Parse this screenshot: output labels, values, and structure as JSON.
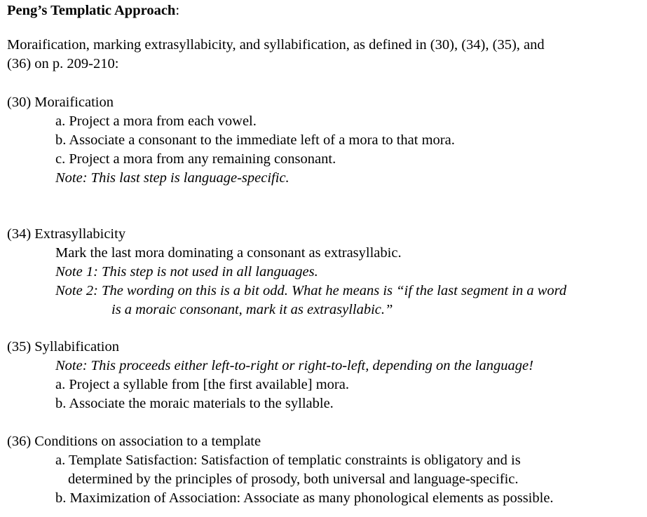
{
  "header": {
    "title": "Peng’s Templatic Approach",
    "title_suffix": ":"
  },
  "intro": {
    "line1": "Moraification, marking extrasyllabicity, and syllabification, as defined in (30), (34), (35), and",
    "line2": "(36) on p. 209-210:"
  },
  "sections": {
    "s30": {
      "heading": "(30) Moraification",
      "a": "a. Project a mora from each vowel.",
      "b": "b. Associate a consonant to the immediate left of a mora to that mora.",
      "c": "c. Project a mora from any remaining consonant.",
      "note": "Note: This last step is language-specific."
    },
    "s34": {
      "heading": "(34) Extrasyllabicity",
      "text": "Mark the last mora dominating a consonant as extrasyllabic.",
      "note1": "Note 1: This step is not used in all languages.",
      "note2_line1": "Note 2: The wording on this is a bit odd. What he means is “if the last segment in a word",
      "note2_line2": "is a moraic consonant, mark it as extrasyllabic.”"
    },
    "s35": {
      "heading": "(35) Syllabification",
      "note": "Note: This proceeds either left-to-right or right-to-left, depending on the language!",
      "a": "a. Project a syllable from [the first available] mora.",
      "b": "b. Associate the moraic materials to the syllable."
    },
    "s36": {
      "heading": "(36) Conditions on association to a template",
      "a_line1": "a. Template Satisfaction: Satisfaction of templatic constraints is obligatory and is",
      "a_line2": "determined by the principles of prosody, both universal and language-specific.",
      "b": "b. Maximization of Association: Associate as many phonological elements as possible."
    }
  }
}
